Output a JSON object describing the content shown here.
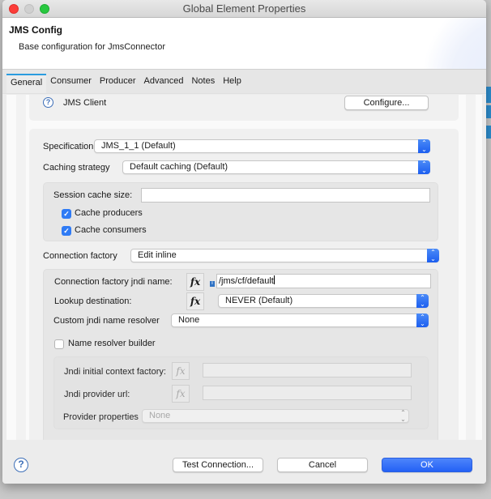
{
  "window": {
    "title": "Global Element Properties"
  },
  "header": {
    "title": "JMS Config",
    "subtitle": "Base configuration for JmsConnector"
  },
  "tabs": [
    {
      "label": "General",
      "active": true
    },
    {
      "label": "Consumer",
      "active": false
    },
    {
      "label": "Producer",
      "active": false
    },
    {
      "label": "Advanced",
      "active": false
    },
    {
      "label": "Notes",
      "active": false
    },
    {
      "label": "Help",
      "active": false
    }
  ],
  "jms_client": {
    "help_icon": "question-circle-icon",
    "label": "JMS Client",
    "configure_button": "Configure..."
  },
  "form": {
    "specification": {
      "label": "Specification:",
      "value": "JMS_1_1 (Default)"
    },
    "caching_strategy": {
      "label": "Caching strategy",
      "value": "Default caching (Default)"
    },
    "session_cache_size": {
      "label": "Session cache size:",
      "value": ""
    },
    "cache_producers": {
      "label": "Cache producers",
      "checked": true
    },
    "cache_consumers": {
      "label": "Cache consumers",
      "checked": true
    },
    "connection_factory": {
      "label": "Connection factory",
      "value": "Edit inline"
    },
    "cf_jndi_name": {
      "label": "Connection factory jndi name:",
      "value": "/jms/cf/default",
      "fx": "fx"
    },
    "lookup_destination": {
      "label": "Lookup destination:",
      "value": "NEVER (Default)",
      "fx": "fx"
    },
    "custom_jndi_resolver": {
      "label": "Custom jndi name resolver",
      "value": "None"
    },
    "name_resolver_builder": {
      "label": "Name resolver builder",
      "checked": false
    },
    "jndi_initial_context_factory": {
      "label": "Jndi initial context factory:",
      "value": "",
      "fx": "fx"
    },
    "jndi_provider_url": {
      "label": "Jndi provider url:",
      "value": "",
      "fx": "fx"
    },
    "provider_properties": {
      "label": "Provider properties",
      "value": "None"
    }
  },
  "footer": {
    "help_icon": "question-circle-icon",
    "test_connection": "Test Connection...",
    "cancel": "Cancel",
    "ok": "OK"
  },
  "colors": {
    "accent": "#2461f5",
    "tab_indicator": "#2b9cdf",
    "close": "#fc3d39",
    "maximize": "#28c840"
  }
}
